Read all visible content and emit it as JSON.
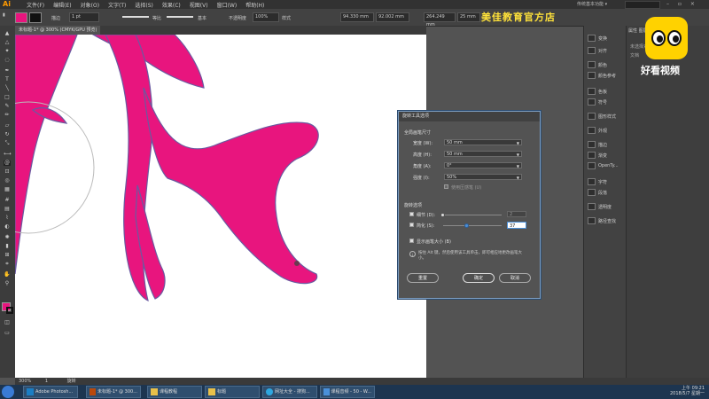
{
  "app": {
    "logo": "Ai",
    "menu": [
      "文件(F)",
      "编辑(E)",
      "对象(O)",
      "文字(T)",
      "选择(S)",
      "效果(C)",
      "视图(V)",
      "窗口(W)",
      "帮助(H)"
    ],
    "workspace": "传统基本功能 ▾",
    "window_controls": "– ▫ ×"
  },
  "control_bar": {
    "fill_color": "#e8157e",
    "stroke_label": "描边",
    "stroke_value": "1 pt",
    "profile_label": "等比",
    "brush_label": "基本",
    "opacity_label": "不透明度",
    "opacity_value": "100%",
    "style_label": "样式",
    "x_value": "94.330 mm",
    "y_value": "92.002 mm",
    "w_value": "264.249 mm",
    "h_value": "25 mm"
  },
  "banner": "美佳教育官方店",
  "document": {
    "tab": "未标题-1* @ 300% (CMYK/GPU 预览)"
  },
  "artwork": {
    "fill": "#e8157e",
    "stroke": "#6a5aa0"
  },
  "panels": {
    "items": [
      "变换",
      "对齐",
      "颜色",
      "颜色参考",
      "色板",
      "符号",
      "图形样式",
      "外观",
      "描边",
      "渐变",
      "OpenTy...",
      "字符",
      "段落",
      "透明度",
      "路径查找"
    ],
    "right_tabs": "属性  图层  库",
    "right_rows": [
      "未选择对象",
      "文档"
    ]
  },
  "watermark": {
    "text": "好看视频"
  },
  "dialog": {
    "title": "旋转工具选项",
    "brush_section": "全局画笔尺寸",
    "fields": [
      {
        "label": "宽度 (W):",
        "value": "50 mm"
      },
      {
        "label": "高度 (H):",
        "value": "50 mm"
      },
      {
        "label": "角度 (A):",
        "value": "0°"
      },
      {
        "label": "强度 (I):",
        "value": "50%"
      }
    ],
    "pressure_label": "使用压感笔 (U)",
    "options_section": "旋转选项",
    "detail_label": "细节 (D):",
    "detail_value": "2",
    "simplify_label": "简化 (S):",
    "simplify_value": "37",
    "show_brush_label": "显示画笔大小 (B)",
    "note": "按住 Alt 键，然后使用该工具单击，即可相应地更改画笔大小。",
    "reset_button": "重置",
    "ok_button": "确定",
    "cancel_button": "取消"
  },
  "status": {
    "zoom": "300%",
    "page": "1",
    "tool": "旋转"
  },
  "taskbar": {
    "tasks": [
      "Adobe Photosh...",
      "未标题-1* @ 300...",
      "课程教程",
      "标题",
      "网址大全 - 搜狗...",
      "课程音频 - 50 - W..."
    ],
    "time": "上午 09:21",
    "date": "2018/5/7 星期一"
  }
}
